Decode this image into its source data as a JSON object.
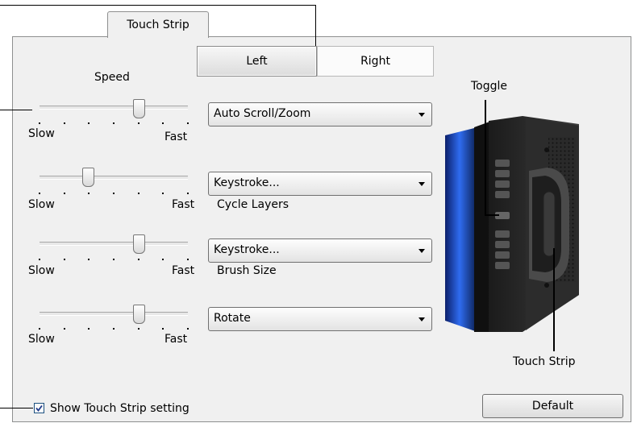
{
  "tab": {
    "label": "Touch Strip"
  },
  "sides": {
    "left_label": "Left",
    "right_label": "Right",
    "selected": "Left"
  },
  "speed": {
    "heading": "Speed",
    "slow_label": "Slow",
    "fast_label": "Fast"
  },
  "strips": [
    {
      "speed_level": 0.67,
      "function": "Auto Scroll/Zoom",
      "detail": ""
    },
    {
      "speed_level": 0.33,
      "function": "Keystroke...",
      "detail": "Cycle Layers"
    },
    {
      "speed_level": 0.67,
      "function": "Keystroke...",
      "detail": "Brush Size"
    },
    {
      "speed_level": 0.67,
      "function": "Rotate",
      "detail": ""
    }
  ],
  "callouts": {
    "toggle": "Toggle",
    "touch_strip": "Touch Strip"
  },
  "show_setting": {
    "label": "Show Touch Strip setting",
    "checked": true
  },
  "buttons": {
    "default_label": "Default"
  }
}
